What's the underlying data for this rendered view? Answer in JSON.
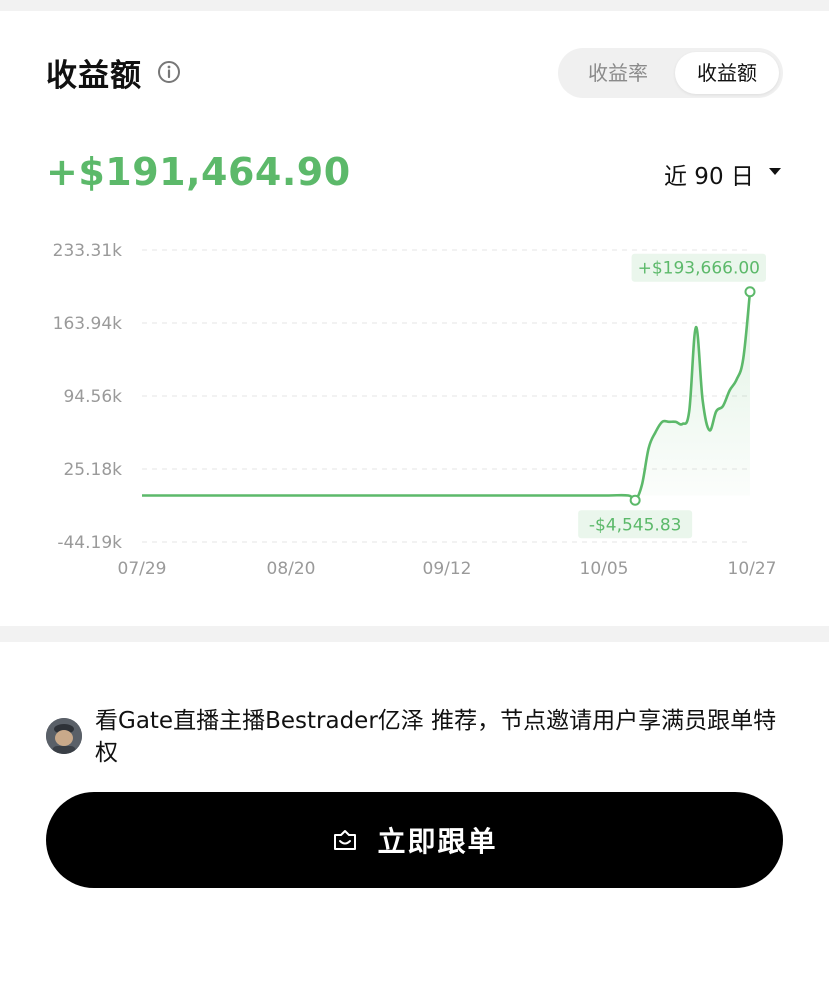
{
  "header": {
    "title": "收益额",
    "info_icon": "info-icon"
  },
  "toggle": {
    "tabs": [
      {
        "label": "收益率",
        "active": false
      },
      {
        "label": "收益额",
        "active": true
      }
    ]
  },
  "summary": {
    "profit_value": "+$191,464.90",
    "period_label": "近 90 日",
    "period_icon": "caret-down-icon"
  },
  "colors": {
    "accent_green": "#5cb96a",
    "button_bg": "#000000"
  },
  "chart_data": {
    "type": "area",
    "y_ticks": [
      "233.31k",
      "163.94k",
      "94.56k",
      "25.18k",
      "-44.19k"
    ],
    "x_ticks": [
      "07/29",
      "08/20",
      "09/12",
      "10/05",
      "10/27"
    ],
    "ylim": [
      -44190,
      233310
    ],
    "grid": true,
    "series": [
      {
        "values_note_units": "USD",
        "x": [
          "07/29",
          "08/05",
          "08/15",
          "08/25",
          "09/05",
          "09/15",
          "09/25",
          "10/05",
          "10/09",
          "10/10",
          "10/11",
          "10/12",
          "10/13",
          "10/14",
          "10/15",
          "10/16",
          "10/17",
          "10/18",
          "10/19",
          "10/20",
          "10/21",
          "10/22",
          "10/23",
          "10/24",
          "10/25",
          "10/26",
          "10/27"
        ],
        "values": [
          0,
          0,
          0,
          0,
          0,
          0,
          0,
          0,
          0,
          -4545.83,
          10000,
          45000,
          60000,
          70000,
          70000,
          70000,
          68000,
          80000,
          160000,
          90000,
          62000,
          80000,
          85000,
          100000,
          110000,
          130000,
          193666
        ]
      }
    ],
    "annotations": [
      {
        "label": "+$193,666.00",
        "date": "10/27",
        "value": 193666
      },
      {
        "label": "-$4,545.83",
        "date": "10/10",
        "value": -4545.83
      }
    ]
  },
  "recommendation": {
    "avatar_icon": "avatar",
    "text": "看Gate直播主播Bestrader亿泽 推荐，节点邀请用户享满员跟单特权"
  },
  "action": {
    "button_label": "立即跟单",
    "button_icon": "copy-trade-icon"
  }
}
